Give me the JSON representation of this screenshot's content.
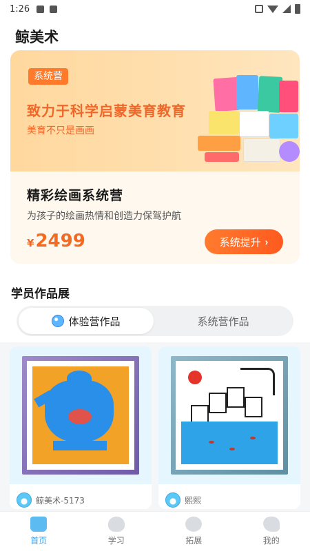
{
  "status_bar": {
    "time": "1:26"
  },
  "app": {
    "title": "鲸美术"
  },
  "hero": {
    "tag": "系统营",
    "headline": "致力于科学启蒙美育教育",
    "subline": "美育不只是画画",
    "course_title": "精彩绘画系统营",
    "course_desc": "为孩子的绘画热情和创造力保驾护航",
    "currency": "¥",
    "price": "2499",
    "button_label": "系统提升",
    "button_icon": "chevron-right-icon"
  },
  "works": {
    "section_title": "学员作品展",
    "tabs": [
      {
        "label": "体验营作品",
        "icon": "palette-icon",
        "selected": true
      },
      {
        "label": "系统营作品",
        "selected": false
      }
    ],
    "items": [
      {
        "author": "鲸美术-5173",
        "frame_color": "#8a76bd"
      },
      {
        "author": "熙熙",
        "frame_color": "#7ea8b9"
      }
    ]
  },
  "nav": {
    "items": [
      {
        "label": "首页",
        "icon": "home-icon",
        "active": true
      },
      {
        "label": "学习",
        "icon": "palette-icon",
        "active": false
      },
      {
        "label": "拓展",
        "icon": "flower-icon",
        "active": false
      },
      {
        "label": "我的",
        "icon": "whale-icon",
        "active": false
      }
    ]
  },
  "colors": {
    "accent": "#f36b21",
    "nav_active": "#3aa0e8"
  }
}
